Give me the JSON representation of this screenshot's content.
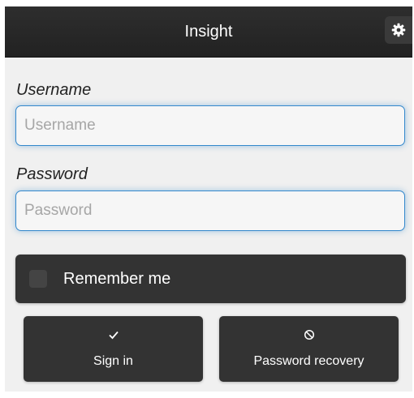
{
  "header": {
    "title": "Insight",
    "settings_icon": "gear-icon"
  },
  "form": {
    "username": {
      "label": "Username",
      "placeholder": "Username",
      "value": ""
    },
    "password": {
      "label": "Password",
      "placeholder": "Password",
      "value": ""
    },
    "remember": {
      "label": "Remember me",
      "checked": false
    }
  },
  "actions": {
    "sign_in": {
      "label": "Sign in",
      "icon": "check-icon"
    },
    "recovery": {
      "label": "Password recovery",
      "icon": "forbidden-icon"
    }
  },
  "colors": {
    "header_bg": "#262626",
    "page_bg": "#f0f0f0",
    "button_bg": "#333333",
    "focus_accent": "#3388cc"
  }
}
